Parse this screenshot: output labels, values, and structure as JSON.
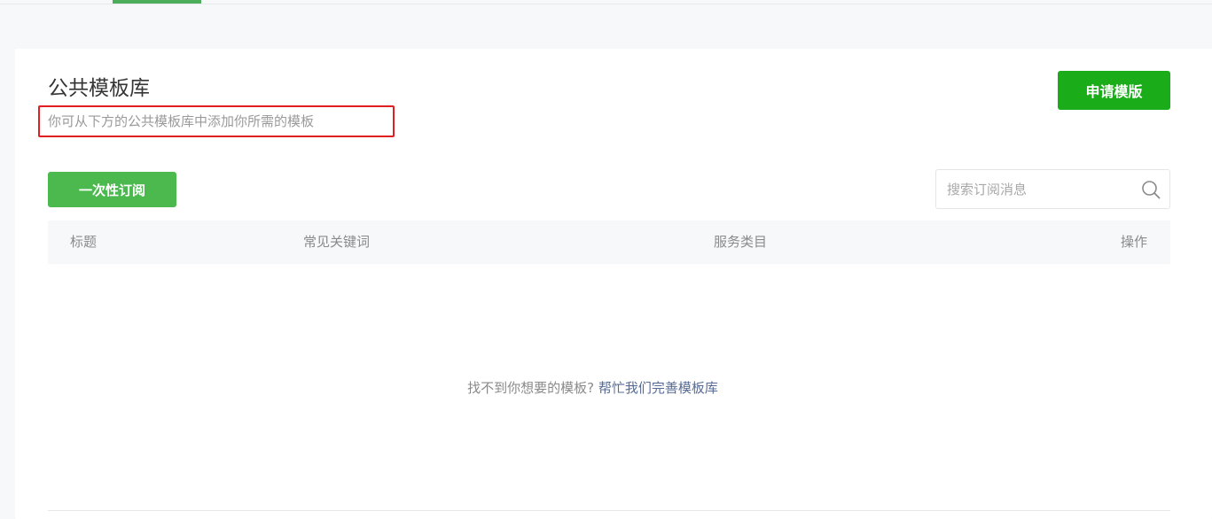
{
  "header": {
    "title": "公共模板库",
    "subtitle": "你可从下方的公共模板库中添加你所需的模板",
    "apply_button": "申请模版"
  },
  "toolbar": {
    "tab_one_time": "一次性订阅",
    "search_placeholder": "搜索订阅消息"
  },
  "table": {
    "columns": {
      "title": "标题",
      "keywords": "常见关键词",
      "category": "服务类目",
      "action": "操作"
    }
  },
  "empty_state": {
    "text": "找不到你想要的模板?",
    "link": "帮忙我们完善模板库"
  },
  "colors": {
    "accent": "#1aad19",
    "tab_active": "#4cb94f",
    "link": "#576b95",
    "highlight_box": "#e02020"
  },
  "icons": {
    "search": "search-icon"
  }
}
